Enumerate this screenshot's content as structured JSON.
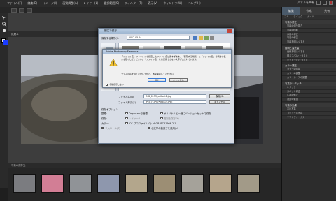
{
  "menubar": {
    "items": [
      "ファイル(F)",
      "編集(E)",
      "イメージ(I)",
      "画質調整(A)",
      "レイヤー(L)",
      "選択範囲(S)",
      "フィルター(T)",
      "表示(V)",
      "ウィンドウ(W)",
      "ヘルプ(H)"
    ],
    "share_label": "パネルを共有"
  },
  "optionbar": {
    "buttons": [
      "",
      "",
      ""
    ]
  },
  "document": {
    "tab_label": "無題-1"
  },
  "bin": {
    "label": "写真の保存先"
  },
  "panel": {
    "tabs": [
      "編集",
      "作成",
      "共有"
    ],
    "subtabs": [
      "フル",
      "クイック",
      "ガイド"
    ],
    "sections": [
      {
        "title": "写真の修正",
        "items": [
          "写真の切り抜き",
          "写真の回転",
          "赤目の修正",
          "写真の修正",
          "写真を明るくする"
        ]
      },
      {
        "title": "照明と露光量",
        "items": [
          "画像を明るくする",
          "明るさ/コントラスト",
          "シャドウ/ハイライト"
        ]
      },
      {
        "title": "カラー補正",
        "items": [
          "カラーの強調",
          "カラーの調整",
          "カラーカーブの調整"
        ]
      },
      {
        "title": "写真のレタッチ",
        "items": [
          "レタッチ",
          "スポット修正",
          "しみの修正",
          "背景の置換"
        ]
      },
      {
        "title": "写真の効果",
        "items": [
          "古い写真",
          "ゴシックな写真",
          "ソフトフォーカス"
        ]
      }
    ]
  },
  "save_dialog": {
    "title": "別名で保存",
    "location_label": "保存する場所(I):",
    "location_value": "2012 05 24",
    "sidebar_label": "最近表示した場所",
    "filename_label": "ファイル名(N):",
    "filename_value": "IMG_0133_edited-1.jpg",
    "format_label": "ファイル形式(F):",
    "format_value": "JPEG (*.JPG;*.JPEG;*.JPE)",
    "save_button": "保存(S)",
    "cancel_button": "キャンセル",
    "options_label": "保存オプション",
    "organize_label": "整理:",
    "organizer_option": "Organizerで管理",
    "version_option": "オリジナルと一緒にバージョンセットで保存",
    "save_label": "保存:",
    "layers_option": "レイヤー(L)",
    "copy_option": "複製を保存(Y)",
    "color_label": "カラー:",
    "icc_option": "ICC プロファイル(C): sRGB IEC61966-2.1",
    "thumb_option": "サムネール(T)",
    "ext_option": "小文字の拡張子を使用(U)"
  },
  "alert": {
    "title": "Adobe Photoshop Elements",
    "message": "「ファイル名」フィールドで指定したファイル名は長すぎます。「保存する場所」と「ファイル名」の両方の長さを短くしてください。「ファイル名」には使用できない文字が含まれています。",
    "message2": "ファイル名を短く変更してから、再度保存してください。",
    "checkbox_label": "今後表示しない",
    "ok_button": "OK",
    "cancel_button": "キャンセル"
  },
  "colors": {
    "panel_bg": "#2c2c2c",
    "accent": "#4a5a6a",
    "warning": "#f0c030"
  }
}
